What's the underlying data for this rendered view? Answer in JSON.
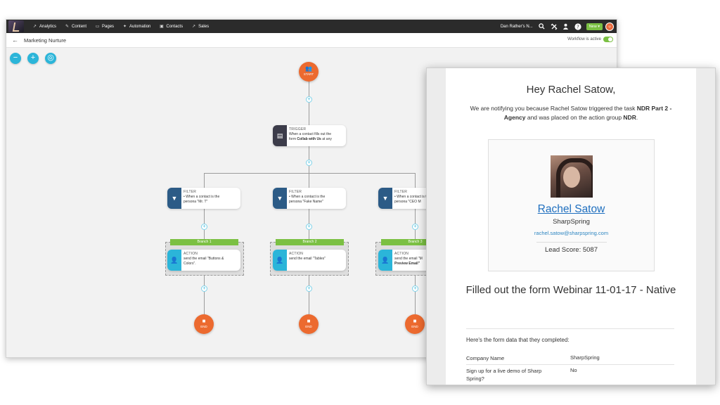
{
  "app": {
    "nav": {
      "items": [
        {
          "label": "Analytics",
          "icon": "analytics-icon",
          "glyph": "↗"
        },
        {
          "label": "Content",
          "icon": "pencil-icon",
          "glyph": "✎"
        },
        {
          "label": "Pages",
          "icon": "pages-icon",
          "glyph": "▭"
        },
        {
          "label": "Automation",
          "icon": "wand-icon",
          "glyph": "✦"
        },
        {
          "label": "Contacts",
          "icon": "contacts-icon",
          "glyph": "▣"
        },
        {
          "label": "Sales",
          "icon": "sales-icon",
          "glyph": "↗"
        }
      ],
      "user": "Dan Rather's N...",
      "new_label": "New"
    },
    "subbar": {
      "title": "Marketing Nurture",
      "status": "Workflow is active"
    },
    "zoom": {
      "minus": "−",
      "plus": "+",
      "center": "◎"
    },
    "workflow": {
      "start": {
        "label": "START",
        "glyph": "👥"
      },
      "trigger": {
        "kind": "TRIGGER",
        "line1": "When a contact fills out the",
        "line2_prefix": "form ",
        "line2_bold": "Collab with Us",
        "line2_suffix": " at any"
      },
      "branches": [
        {
          "filter": {
            "kind": "FILTER",
            "line1": "• When a contact is the",
            "line2": "persona \"Mr. T\""
          },
          "branch_label": "Branch 1",
          "action": {
            "kind": "ACTION",
            "line1": "send the email \"Buttons &",
            "line2": "Colors\"."
          },
          "end": "END"
        },
        {
          "filter": {
            "kind": "FILTER",
            "line1": "• When a contact is the",
            "line2": "persona \"Fake Name\""
          },
          "branch_label": "Branch 2",
          "action": {
            "kind": "ACTION",
            "line1": "send the email \"Tables\"",
            "line2": ""
          },
          "end": "END"
        },
        {
          "filter": {
            "kind": "FILTER",
            "line1": "• When a contact is the",
            "line2": "persona \"CEO M"
          },
          "branch_label": "Branch 3",
          "action": {
            "kind": "ACTION",
            "line1": "send the email \"M",
            "line2": "Preview Email\""
          },
          "end": "END"
        }
      ]
    }
  },
  "email": {
    "greeting": "Hey Rachel Satow,",
    "message": {
      "part1": "We are notifying you because Rachel Satow triggered the task ",
      "bold1": "NDR Part 2 - Agency",
      "part2": " and was placed on the action group ",
      "bold2": "NDR",
      "part3": "."
    },
    "profile": {
      "name": "Rachel Satow",
      "company": "SharpSpring",
      "email": "rachel.satow@sharpspring.com",
      "lead_score": "Lead Score: 5087"
    },
    "form_title": "Filled out the form Webinar 11-01-17 - Native",
    "form_intro": "Here's the form data that they completed:",
    "form_rows": [
      {
        "key": "Company Name",
        "value": "SharpSpring"
      },
      {
        "key": "Sign up for a live demo of Sharp Spring?",
        "value": "No"
      }
    ]
  }
}
